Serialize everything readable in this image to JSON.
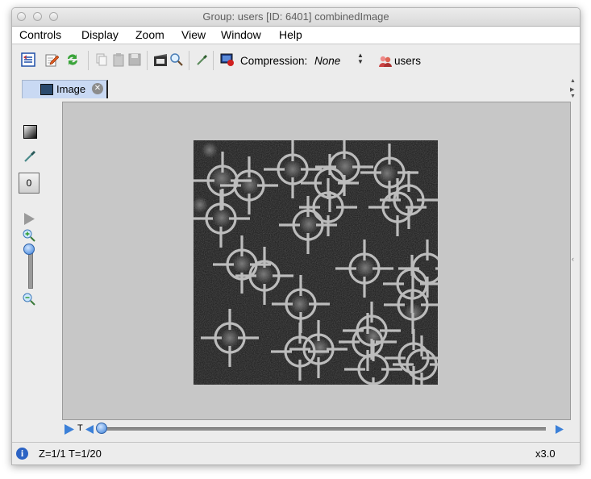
{
  "window": {
    "title": "Group: users [ID: 6401] combinedImage"
  },
  "menu": {
    "items": [
      "Controls",
      "Display",
      "Zoom",
      "View",
      "Window",
      "Help"
    ]
  },
  "toolbar": {
    "compression_label": "Compression:",
    "compression_value": "None",
    "group_label": "users",
    "icons": [
      "metadata-icon",
      "edit-icon",
      "refresh-icon",
      "copy-icon",
      "paste-icon",
      "save-icon",
      "movie-icon",
      "magnify-icon",
      "pipette-icon",
      "image-compression-icon",
      "users-icon"
    ]
  },
  "tabs": [
    {
      "label": "Image",
      "icon": "image-icon",
      "active": true
    }
  ],
  "sidebar": {
    "channel_value": "0",
    "icons": [
      "channel-toggle-icon",
      "color-picker-icon",
      "play-z-icon",
      "zoom-in-icon",
      "zoom-out-icon"
    ]
  },
  "playbar": {
    "t_label": "T"
  },
  "status": {
    "text": "Z=1/1 T=1/20",
    "zoom": "x3.0"
  },
  "colors": {
    "tab_bg": "#c9d9f3",
    "viewport_bg": "#c7c7c7",
    "canvas_bg": "#171717",
    "marker": "#bcbcbc",
    "accent": "#2c63c4"
  }
}
